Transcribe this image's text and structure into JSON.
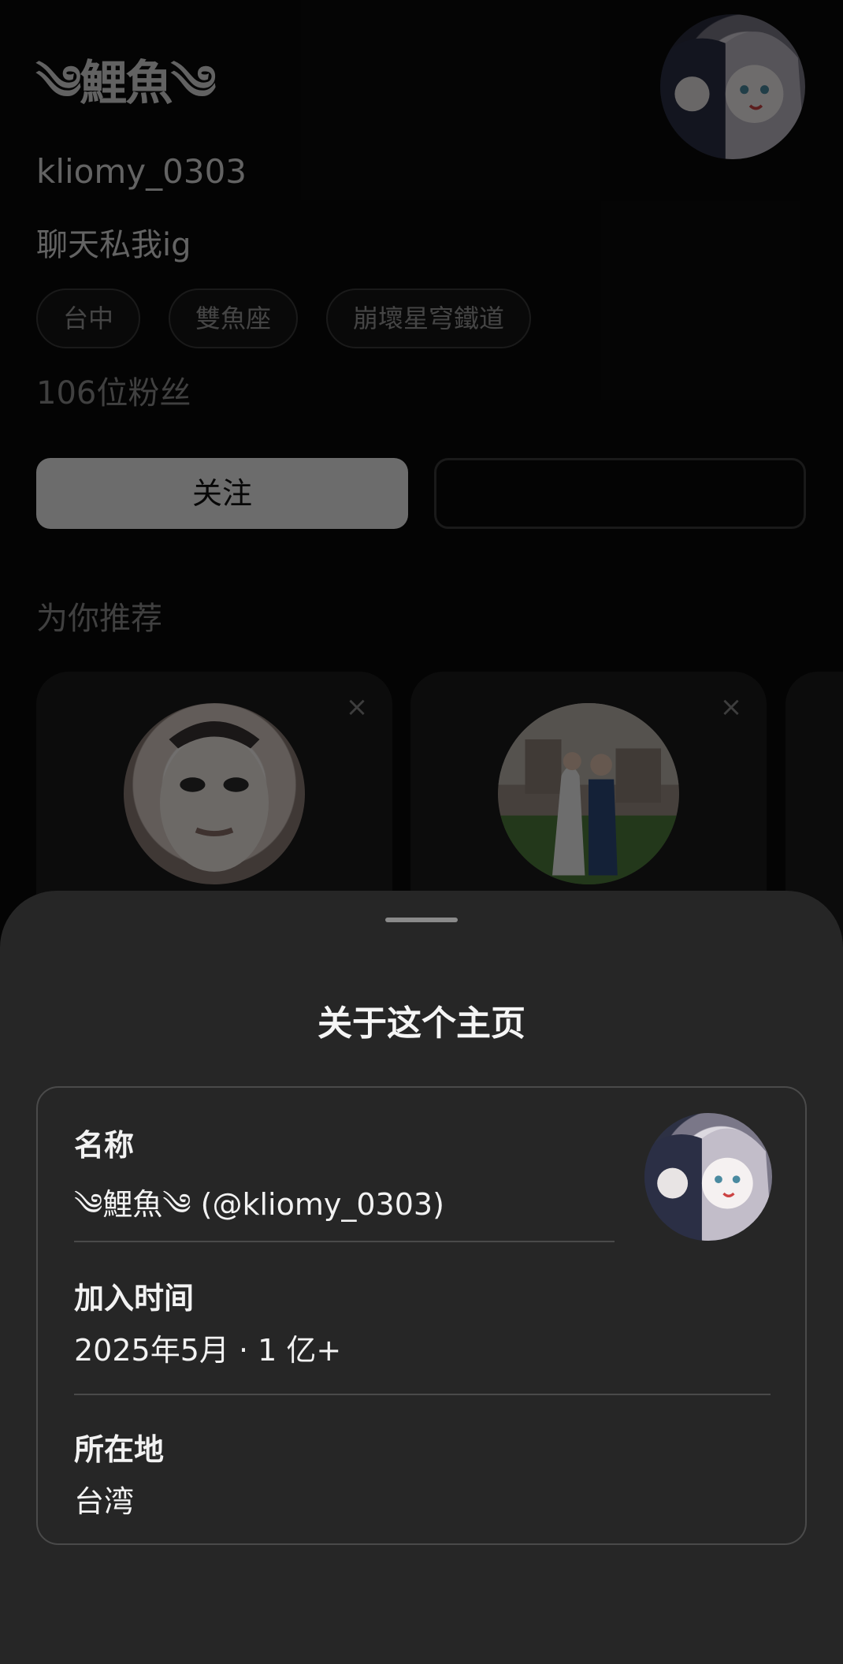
{
  "profile": {
    "display_name": "༄鯉魚༄",
    "username": "kliomy_0303",
    "bio": "聊天私我ig",
    "tags": [
      "台中",
      "雙魚座",
      "崩壞星穹鐵道"
    ],
    "followers": "106位粉丝",
    "follow_button": "关注",
    "recommend_title": "为你推荐"
  },
  "sheet": {
    "title": "关于这个主页",
    "name_label": "名称",
    "name_value": "༄鯉魚༄ (@kliomy_0303)",
    "joined_label": "加入时间",
    "joined_value": "2025年5月 · 1 亿+",
    "location_label": "所在地",
    "location_value": "台湾"
  },
  "icons": {
    "close": "close-icon"
  }
}
